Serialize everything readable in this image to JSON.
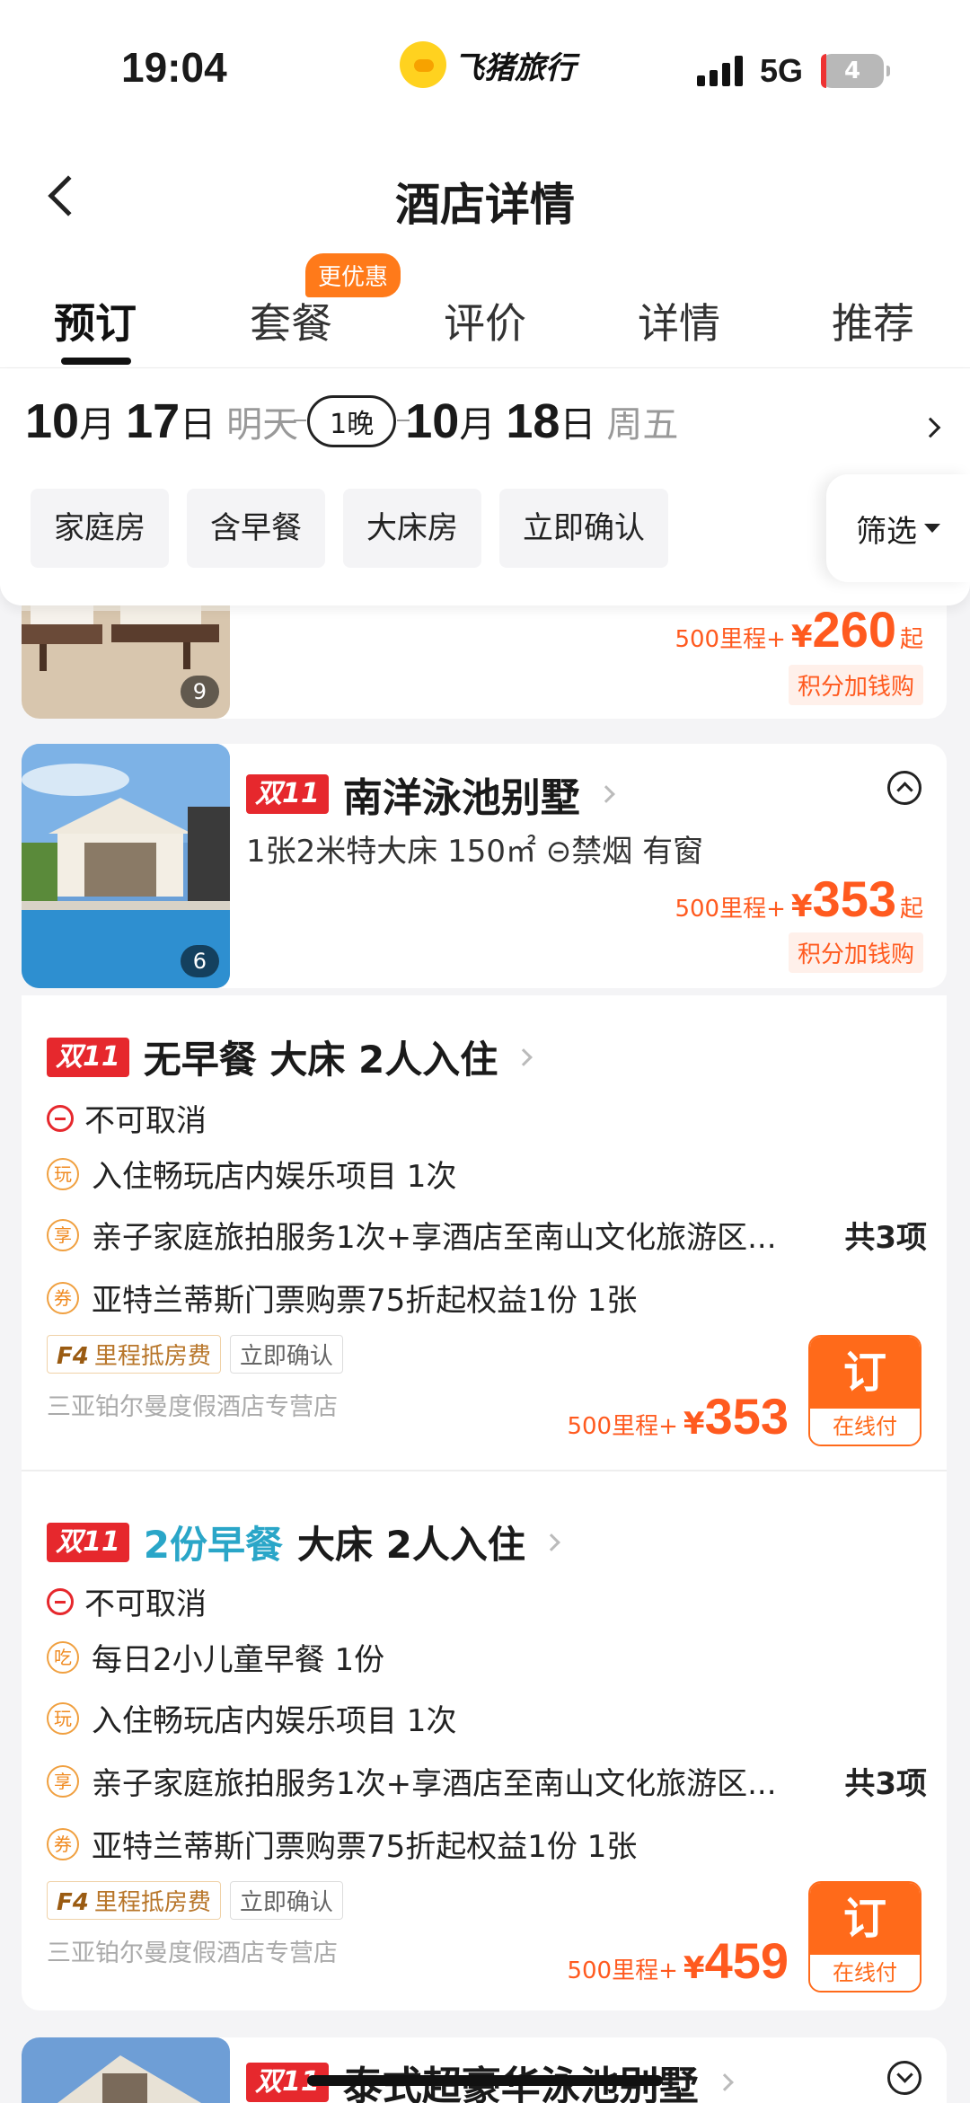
{
  "status": {
    "time": "19:04",
    "network": "5G",
    "battery": "4"
  },
  "brand": {
    "name": "飞猪旅行"
  },
  "nav": {
    "title": "酒店详情"
  },
  "tabs": [
    {
      "label": "预订",
      "active": true
    },
    {
      "label": "套餐",
      "badge": "更优惠"
    },
    {
      "label": "评价"
    },
    {
      "label": "详情"
    },
    {
      "label": "推荐"
    }
  ],
  "dates": {
    "checkin_month": "10",
    "checkin_day": "17",
    "checkin_note": "明天",
    "nights": "1晚",
    "checkout_month": "10",
    "checkout_day": "18",
    "checkout_note": "周五",
    "month_unit": "月",
    "day_unit": "日"
  },
  "filters": {
    "chips": [
      "家庭房",
      "含早餐",
      "大床房",
      "立即确认"
    ],
    "filter_label": "筛选"
  },
  "room_prev": {
    "image_count": "9",
    "miles": "500里程+",
    "yen": "¥",
    "price": "260",
    "from": "起",
    "points": "积分加钱购"
  },
  "room_main": {
    "badge": "双11",
    "name": "南洋泳池别墅",
    "specs": "1张2米特大床   150㎡   ⊝禁烟   有窗",
    "image_count": "6",
    "miles": "500里程+",
    "yen": "¥",
    "price": "353",
    "from": "起",
    "points": "积分加钱购"
  },
  "plans": [
    {
      "badge": "双11",
      "title_hl": "",
      "title": "无早餐 大床 2人入住",
      "cancel": "不可取消",
      "lines": [
        {
          "icon": "玩",
          "text": "入住畅玩店内娱乐项目 1次"
        },
        {
          "icon": "享",
          "text": "亲子家庭旅拍服务1次+享酒店至南山文化旅游区...",
          "total": "共3项"
        },
        {
          "icon": "券",
          "text": "亚特兰蒂斯门票购票75折起权益1份 1张"
        }
      ],
      "tags": {
        "f4": "F4",
        "f4_label": "里程抵房费",
        "confirm": "立即确认"
      },
      "store": "三亚铂尔曼度假酒店专营店",
      "miles": "500里程+",
      "yen": "¥",
      "price": "353",
      "book": "订",
      "pay": "在线付"
    },
    {
      "badge": "双11",
      "title_hl": "2份早餐",
      "title": "大床 2人入住",
      "cancel": "不可取消",
      "lines": [
        {
          "icon": "吃",
          "text": "每日2小儿童早餐 1份"
        },
        {
          "icon": "玩",
          "text": "入住畅玩店内娱乐项目 1次"
        },
        {
          "icon": "享",
          "text": "亲子家庭旅拍服务1次+享酒店至南山文化旅游区...",
          "total": "共3项"
        },
        {
          "icon": "券",
          "text": "亚特兰蒂斯门票购票75折起权益1份 1张"
        }
      ],
      "tags": {
        "f4": "F4",
        "f4_label": "里程抵房费",
        "confirm": "立即确认"
      },
      "store": "三亚铂尔曼度假酒店专营店",
      "miles": "500里程+",
      "yen": "¥",
      "price": "459",
      "book": "订",
      "pay": "在线付"
    }
  ],
  "room_next": {
    "badge": "双11",
    "name": "泰式超豪华泳池别墅"
  }
}
